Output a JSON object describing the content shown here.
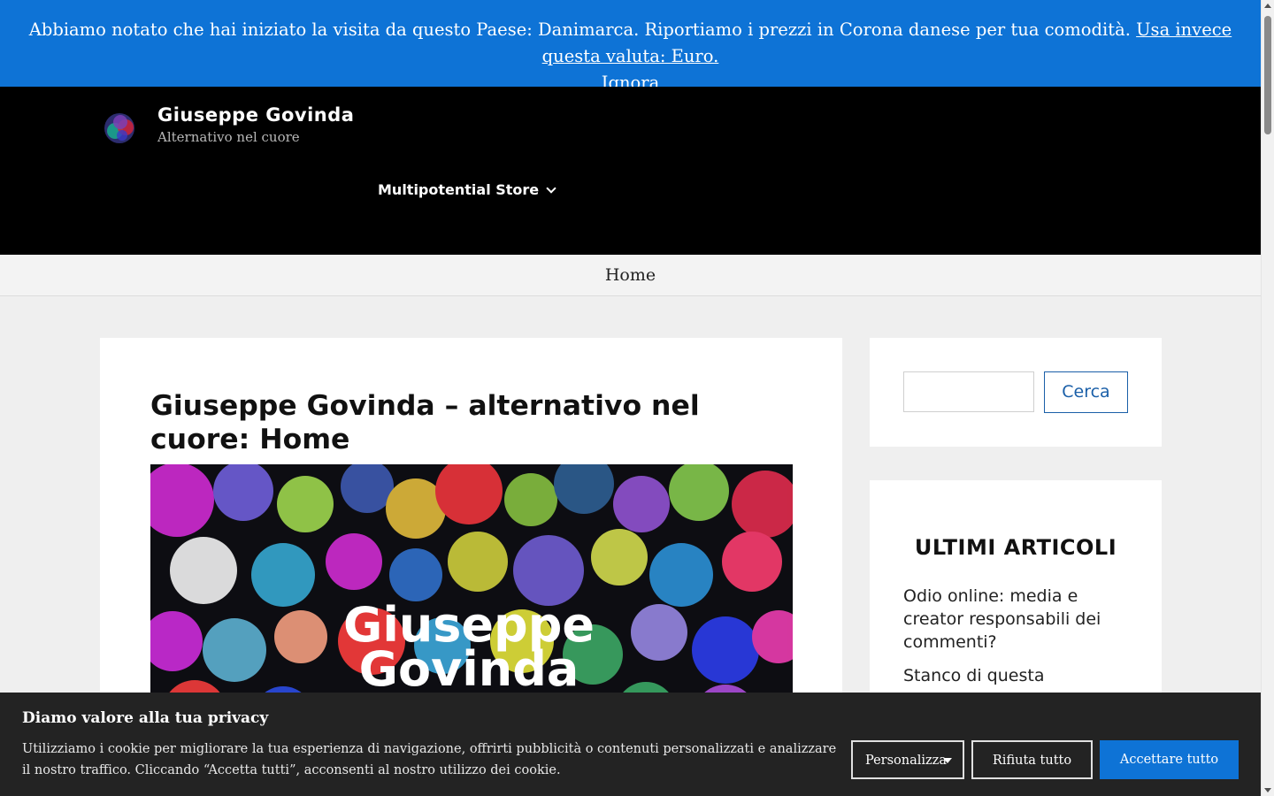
{
  "notice": {
    "message": "Abbiamo notato che hai iniziato la visita da questo Paese: Danimarca. Riportiamo i prezzi in Corona danese per tua comodità.",
    "switch_link": "Usa invece questa valuta: Euro.",
    "dismiss_link": "Ignora"
  },
  "header": {
    "site_title": "Giuseppe Govinda",
    "tagline": "Alternativo nel cuore",
    "nav": [
      {
        "label": "Multipotential Store",
        "has_dropdown": true
      }
    ]
  },
  "breadcrumb": {
    "home": "Home"
  },
  "main": {
    "post_title": "Giuseppe Govinda – alternativo nel cuore: Home",
    "featured_image_text_line1": "Giuseppe",
    "featured_image_text_line2": "Govinda"
  },
  "sidebar": {
    "search": {
      "input_value": "",
      "button_label": "Cerca"
    },
    "recent": {
      "title": "ULTIMI ARTICOLI",
      "items": [
        "Odio online: media e creator responsabili dei commenti?",
        "Stanco di questa"
      ]
    }
  },
  "cookie_banner": {
    "title": "Diamo valore alla tua privacy",
    "text": "Utilizziamo i cookie per migliorare la tua esperienza di navigazione, offrirti pubblicità o contenuti personalizzati e analizzare il nostro traffico. Cliccando “Accetta tutti”, acconsenti al nostro utilizzo dei cookie.",
    "customize_label": "Personalizza",
    "reject_label": "Rifiuta tutto",
    "accept_label": "Accettare tutto"
  },
  "colors": {
    "notice_bg": "#0e73d6",
    "header_bg": "#000000",
    "accept_bg": "#0e73d6",
    "search_btn": "#1a5fa8",
    "cookie_bg": "#232323"
  }
}
